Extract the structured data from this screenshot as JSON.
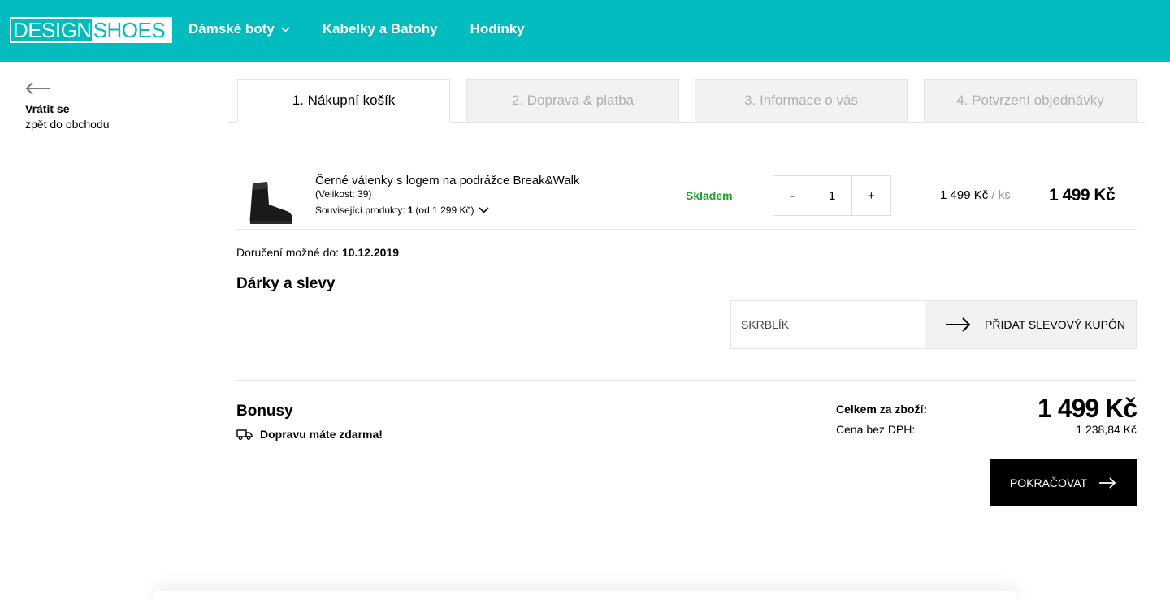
{
  "header": {
    "logo_design": "DESIGN",
    "logo_shoes": "SHOES",
    "nav": [
      {
        "label": "Dámské boty",
        "has_dropdown": true
      },
      {
        "label": "Kabelky a Batohy"
      },
      {
        "label": "Hodinky"
      }
    ],
    "brand_color": "#00BCBE"
  },
  "back": {
    "line1": "Vrátit se",
    "line2": "zpět do obchodu"
  },
  "steps": [
    {
      "label": "1. Nákupní košík",
      "active": true
    },
    {
      "label": "2. Doprava & platba"
    },
    {
      "label": "3. Informace o vás"
    },
    {
      "label": "4. Potvrzení objednávky"
    }
  ],
  "cart": {
    "item": {
      "name": "Černé válenky s logem na podrážce Break&Walk",
      "size": "(Velikost: 39)",
      "related_label": "Související produkty:",
      "related_count": "1",
      "related_from": "(od 1 299 Kč)",
      "stock": "Skladem",
      "qty_minus": "-",
      "qty": "1",
      "qty_plus": "+",
      "unit_price": "1 499 Kč",
      "unit_suffix": "/ ks",
      "total": "1 499 Kč"
    }
  },
  "delivery": {
    "label": "Doručení možné do:",
    "date": "10.12.2019"
  },
  "gifts": {
    "title": "Dárky a slevy",
    "coupon_placeholder": "SKRBLÍK",
    "coupon_button": "PŘIDAT SLEVOVÝ KUPÓN"
  },
  "bonus": {
    "title": "Bonusy",
    "free_shipping": "Dopravu máte zdarma!"
  },
  "summary": {
    "total_label": "Celkem za zboží:",
    "total": "1 499 Kč",
    "net_label": "Cena bez DPH:",
    "net": "1 238,84 Kč"
  },
  "continue_button": "POKRAČOVAT"
}
